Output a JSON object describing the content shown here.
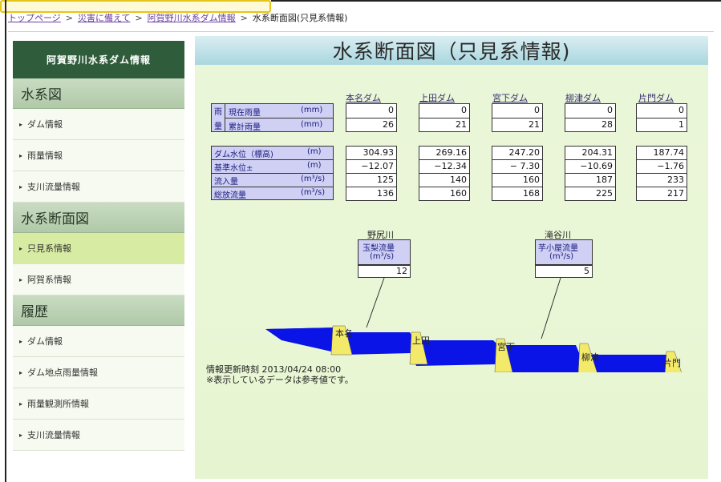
{
  "breadcrumb": {
    "items": [
      "トップページ",
      "災害に備えて",
      "阿賀野川水系ダム情報"
    ],
    "current": "水系断面図(只見系情報)"
  },
  "sidebar": {
    "title": "阿賀野川水系ダム情報",
    "sections": [
      {
        "heading": "水系図",
        "items": [
          "ダム情報",
          "雨量情報",
          "支川流量情報"
        ]
      },
      {
        "heading": "水系断面図",
        "items": [
          "只見系情報",
          "阿賀系情報"
        ],
        "active_index": 0
      },
      {
        "heading": "履歴",
        "items": [
          "ダム情報",
          "ダム地点雨量情報",
          "雨量観測所情報",
          "支川流量情報"
        ]
      }
    ]
  },
  "main": {
    "title": "水系断面図（只見系情報)",
    "dams": [
      "本名ダム",
      "上田ダム",
      "宮下ダム",
      "柳津ダム",
      "片門ダム"
    ],
    "rain": {
      "group_label_top": "雨",
      "group_label_bottom": "量",
      "rows": [
        {
          "label": "現在雨量",
          "unit": "(mm)",
          "values": [
            "0",
            "0",
            "0",
            "0",
            "0"
          ]
        },
        {
          "label": "累計雨量",
          "unit": "(mm)",
          "values": [
            "26",
            "21",
            "21",
            "28",
            "1"
          ]
        }
      ]
    },
    "water": {
      "rows": [
        {
          "label": "ダム水位（標高)",
          "unit": "(m)",
          "values": [
            "304.93",
            "269.16",
            "247.20",
            "204.31",
            "187.74"
          ]
        },
        {
          "label": "基準水位±",
          "unit": "(m)",
          "values": [
            "−12.07",
            "−12.34",
            "− 7.30",
            "−10.69",
            "−1.76"
          ]
        },
        {
          "label": "流入量",
          "unit": "(m³/s)",
          "values": [
            "125",
            "140",
            "160",
            "187",
            "233"
          ]
        },
        {
          "label": "総放流量",
          "unit": "(m³/s)",
          "values": [
            "136",
            "160",
            "168",
            "225",
            "217"
          ]
        }
      ]
    },
    "tributaries": [
      {
        "river": "野尻川",
        "label1": "玉梨流量",
        "label2": "(m³/s)",
        "value": "12"
      },
      {
        "river": "滝谷川",
        "label1": "芋小屋流量",
        "label2": "(m³/s)",
        "value": "5"
      }
    ],
    "profile_dams": [
      "本名",
      "上田",
      "宮下",
      "柳津",
      "片門"
    ],
    "update_time": "情報更新時刻 2013/04/24 08:00",
    "note": "※表示しているデータは参考値です。",
    "colors": {
      "water": "#0a14e6",
      "dam": "#f4ea6a"
    }
  }
}
